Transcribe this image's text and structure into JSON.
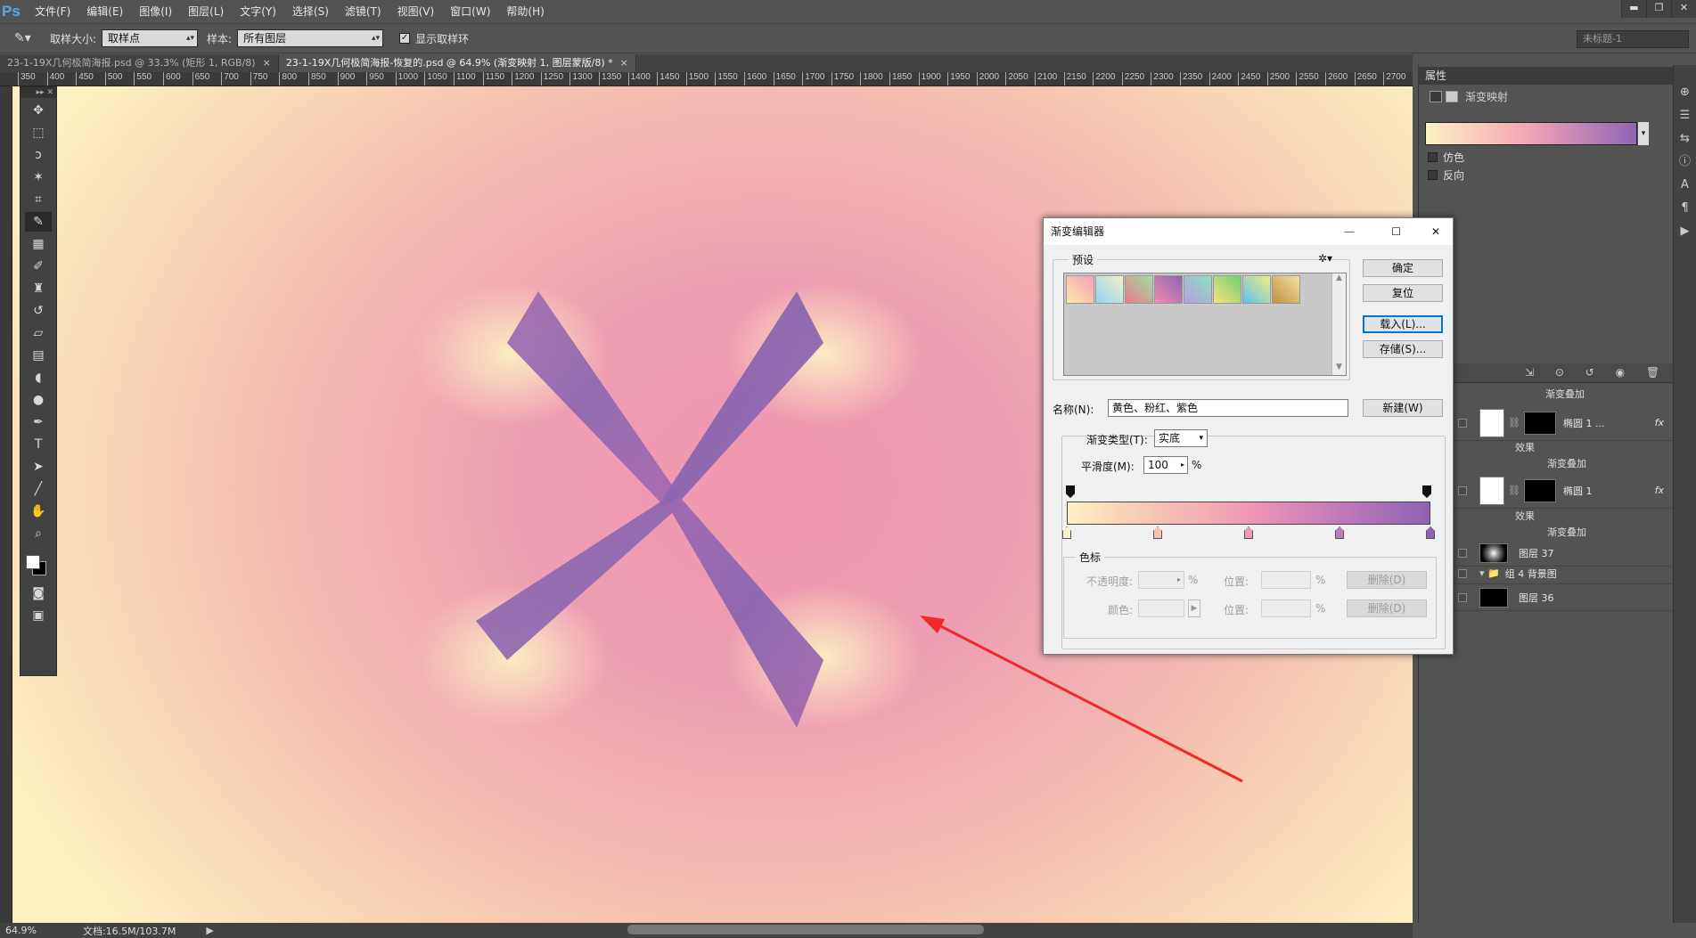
{
  "app": {
    "logo": "Ps"
  },
  "menu": [
    "文件(F)",
    "编辑(E)",
    "图像(I)",
    "图层(L)",
    "文字(Y)",
    "选择(S)",
    "滤镜(T)",
    "视图(V)",
    "窗口(W)",
    "帮助(H)"
  ],
  "window_controls": [
    "▬",
    "❐",
    "✕"
  ],
  "options": {
    "sample_size_label": "取样大小:",
    "sample_size_value": "取样点",
    "sample_label": "样本:",
    "sample_value": "所有图层",
    "show_ring_label": "显示取样环",
    "workspace": "未标题-1"
  },
  "tabs": [
    {
      "title": "23-1-19X几何极简海报.psd @ 33.3% (矩形 1, RGB/8)",
      "close": "×"
    },
    {
      "title": "23-1-19X几何极简海报-恢复的.psd @ 64.9% (渐变映射 1, 图层蒙版/8) *",
      "close": "×"
    }
  ],
  "ruler_ticks": [
    "350",
    "400",
    "450",
    "500",
    "550",
    "600",
    "650",
    "700",
    "750",
    "800",
    "850",
    "900",
    "950",
    "1000",
    "1050",
    "1100",
    "1150",
    "1200",
    "1250",
    "1300",
    "1350",
    "1400",
    "1450",
    "1500",
    "1550",
    "1600",
    "1650",
    "1700",
    "1750",
    "1800",
    "1850",
    "1900",
    "1950",
    "2000",
    "2050",
    "2100",
    "2150",
    "2200",
    "2250",
    "2300",
    "2350",
    "2400",
    "2450",
    "2500",
    "2550",
    "2600",
    "2650",
    "2700"
  ],
  "tools": [
    "move-icon",
    "marquee-icon",
    "lasso-icon",
    "magic-wand-icon",
    "crop-icon",
    "eyedropper-icon",
    "healing-icon",
    "brush-icon",
    "stamp-icon",
    "history-brush-icon",
    "eraser-icon",
    "gradient-icon",
    "blur-icon",
    "dodge-icon",
    "pen-icon",
    "type-icon",
    "path-select-icon",
    "line-icon",
    "hand-icon",
    "zoom-icon"
  ],
  "properties": {
    "header": "属性",
    "title": "渐变映射",
    "dither": "仿色",
    "reverse": "反向",
    "gradient_colors": [
      "#fdf0c2",
      "#f4a6b6",
      "#8f64b4"
    ]
  },
  "layers": {
    "partial_top": "渐变叠加",
    "rows": [
      {
        "name": "椭圆 1 ...",
        "fx": "fx",
        "effects": "效果",
        "effect_name": "渐变叠加"
      },
      {
        "name": "椭圆 1",
        "fx": "fx",
        "effects": "效果",
        "effect_name": "渐变叠加"
      },
      {
        "name": "图层 37"
      },
      {
        "name": "组 4 背景图"
      },
      {
        "name": "图层 36"
      }
    ]
  },
  "status": {
    "zoom": "64.9%",
    "doc": "文档:16.5M/103.7M"
  },
  "dialog": {
    "title": "渐变编辑器",
    "presets_label": "预设",
    "presets": [
      [
        "#fde9a8",
        "#f4a0b8"
      ],
      [
        "#8fd4f2",
        "#f6f0c8"
      ],
      [
        "#e87a8a",
        "#9fe0a0"
      ],
      [
        "#f08ab0",
        "#8f64b4"
      ],
      [
        "#b0a0e0",
        "#90e0c0"
      ],
      [
        "#f8e080",
        "#70d070"
      ],
      [
        "#60c0f0",
        "#f0f080"
      ],
      [
        "#c09040",
        "#f4e0a0"
      ]
    ],
    "buttons": {
      "ok": "确定",
      "reset": "复位",
      "load": "载入(L)...",
      "save": "存储(S)...",
      "new": "新建(W)"
    },
    "name_label": "名称(N):",
    "name_value": "黄色、粉红、紫色",
    "type_label": "渐变类型(T):",
    "type_value": "实底",
    "smooth_label": "平滑度(M):",
    "smooth_value": "100",
    "percent": "%",
    "stops_label": "色标",
    "opacity_label": "不透明度:",
    "position_label": "位置:",
    "color_label": "颜色:",
    "delete_label": "删除(D)",
    "gradient": {
      "stops": [
        "#fdf0c2",
        "#f6c3b4",
        "#f197b6",
        "#c07ab8",
        "#8f64b4"
      ]
    },
    "min": "—",
    "max": "☐",
    "close": "✕"
  }
}
